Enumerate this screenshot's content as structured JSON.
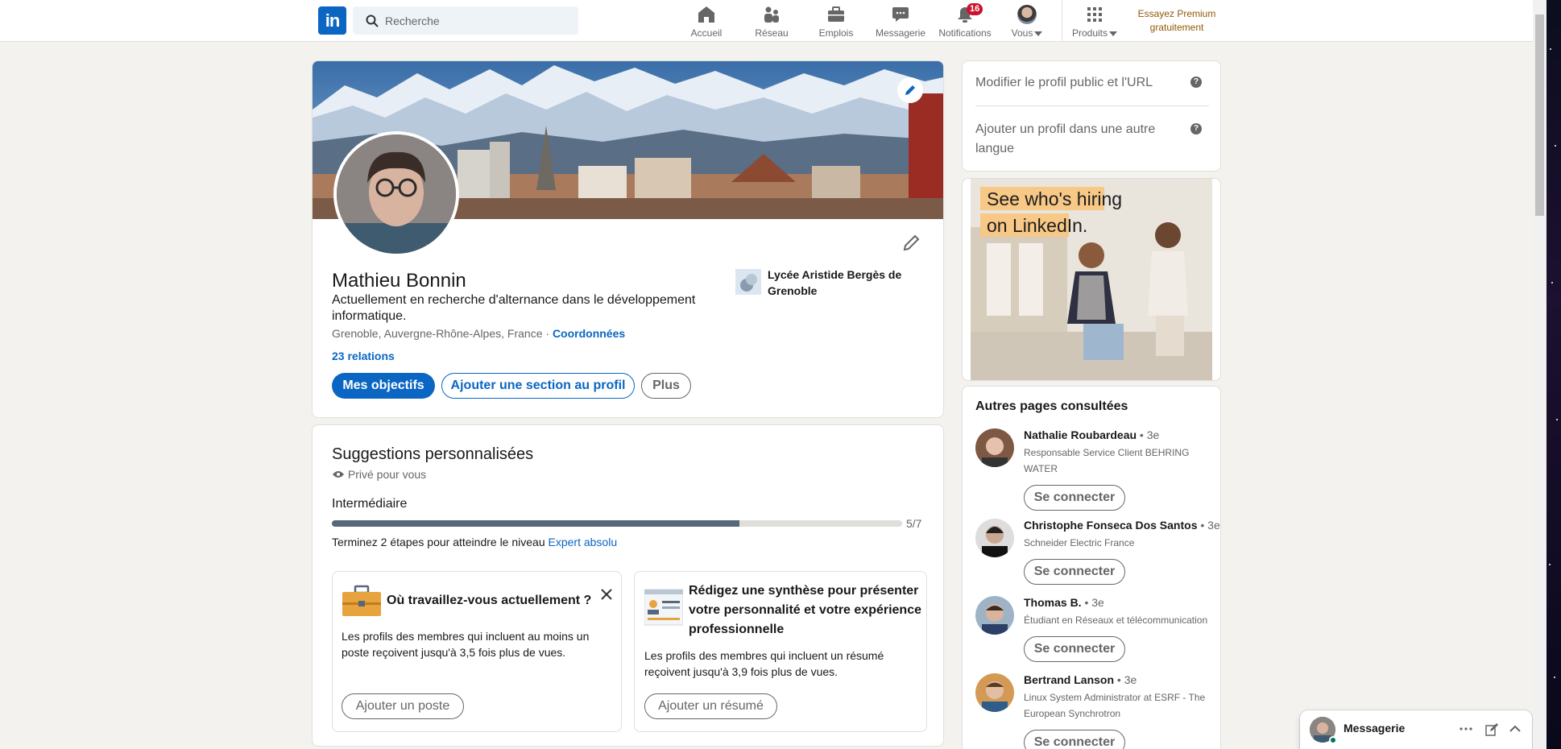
{
  "nav": {
    "logo": "in",
    "search_placeholder": "Recherche",
    "items": [
      {
        "label": "Accueil"
      },
      {
        "label": "Réseau"
      },
      {
        "label": "Emplois"
      },
      {
        "label": "Messagerie"
      },
      {
        "label": "Notifications",
        "badge": "16"
      },
      {
        "label": "Vous"
      },
      {
        "label": "Produits"
      }
    ],
    "premium": "Essayez Premium gratuitement"
  },
  "profile": {
    "name": "Mathieu Bonnin",
    "headline": "Actuellement en recherche d'alternance dans le développement informatique.",
    "location": "Grenoble, Auvergne-Rhône-Alpes, France",
    "location_sep": " · ",
    "contact_link": "Coordonnées",
    "relations": "23 relations",
    "school": "Lycée Aristide Bergès de Grenoble",
    "btn_goals": "Mes objectifs",
    "btn_add_section": "Ajouter une section au profil",
    "btn_more": "Plus"
  },
  "suggestions": {
    "title": "Suggestions personnalisées",
    "private": "Privé pour vous",
    "level": "Intermédiaire",
    "progress_value": "5/7",
    "progress_fraction": 0.714,
    "next_text": "Terminez 2 étapes pour atteindre le niveau ",
    "next_level": "Expert absolu",
    "card1": {
      "title": "Où travaillez-vous actuellement ?",
      "desc": "Les profils des membres qui incluent au moins un poste reçoivent jusqu'à 3,5 fois plus de vues.",
      "button": "Ajouter un poste"
    },
    "card2": {
      "title": "Rédigez une synthèse pour présenter votre personnalité et votre expérience professionnelle",
      "desc": "Les profils des membres qui incluent un résumé reçoivent jusqu'à 3,9 fois plus de vues.",
      "button": "Ajouter un résumé"
    }
  },
  "sidebar": {
    "link1": "Modifier le profil public et l'URL",
    "link2": "Ajouter un profil dans une autre langue",
    "ad_line1": "See who's hiring",
    "ad_line2": "on LinkedIn.",
    "people_title": "Autres pages consultées",
    "people": [
      {
        "name": "Nathalie Roubardeau",
        "degree": " • 3e",
        "desc": "Responsable Service Client BEHRING WATER",
        "button": "Se connecter"
      },
      {
        "name": "Christophe Fonseca Dos Santos",
        "degree": " • 3e",
        "desc": "Schneider Electric France",
        "button": "Se connecter"
      },
      {
        "name": "Thomas B.",
        "degree": " • 3e",
        "desc": "Étudiant en Réseaux et télécommunication",
        "button": "Se connecter"
      },
      {
        "name": "Bertrand Lanson",
        "degree": " • 3e",
        "desc": "Linux System Administrator at ESRF - The European Synchrotron",
        "button": "Se connecter"
      }
    ]
  },
  "messaging": {
    "label": "Messagerie"
  },
  "colors": {
    "brand": "#0a66c2",
    "premium": "#915907",
    "badge": "#cb112d"
  }
}
